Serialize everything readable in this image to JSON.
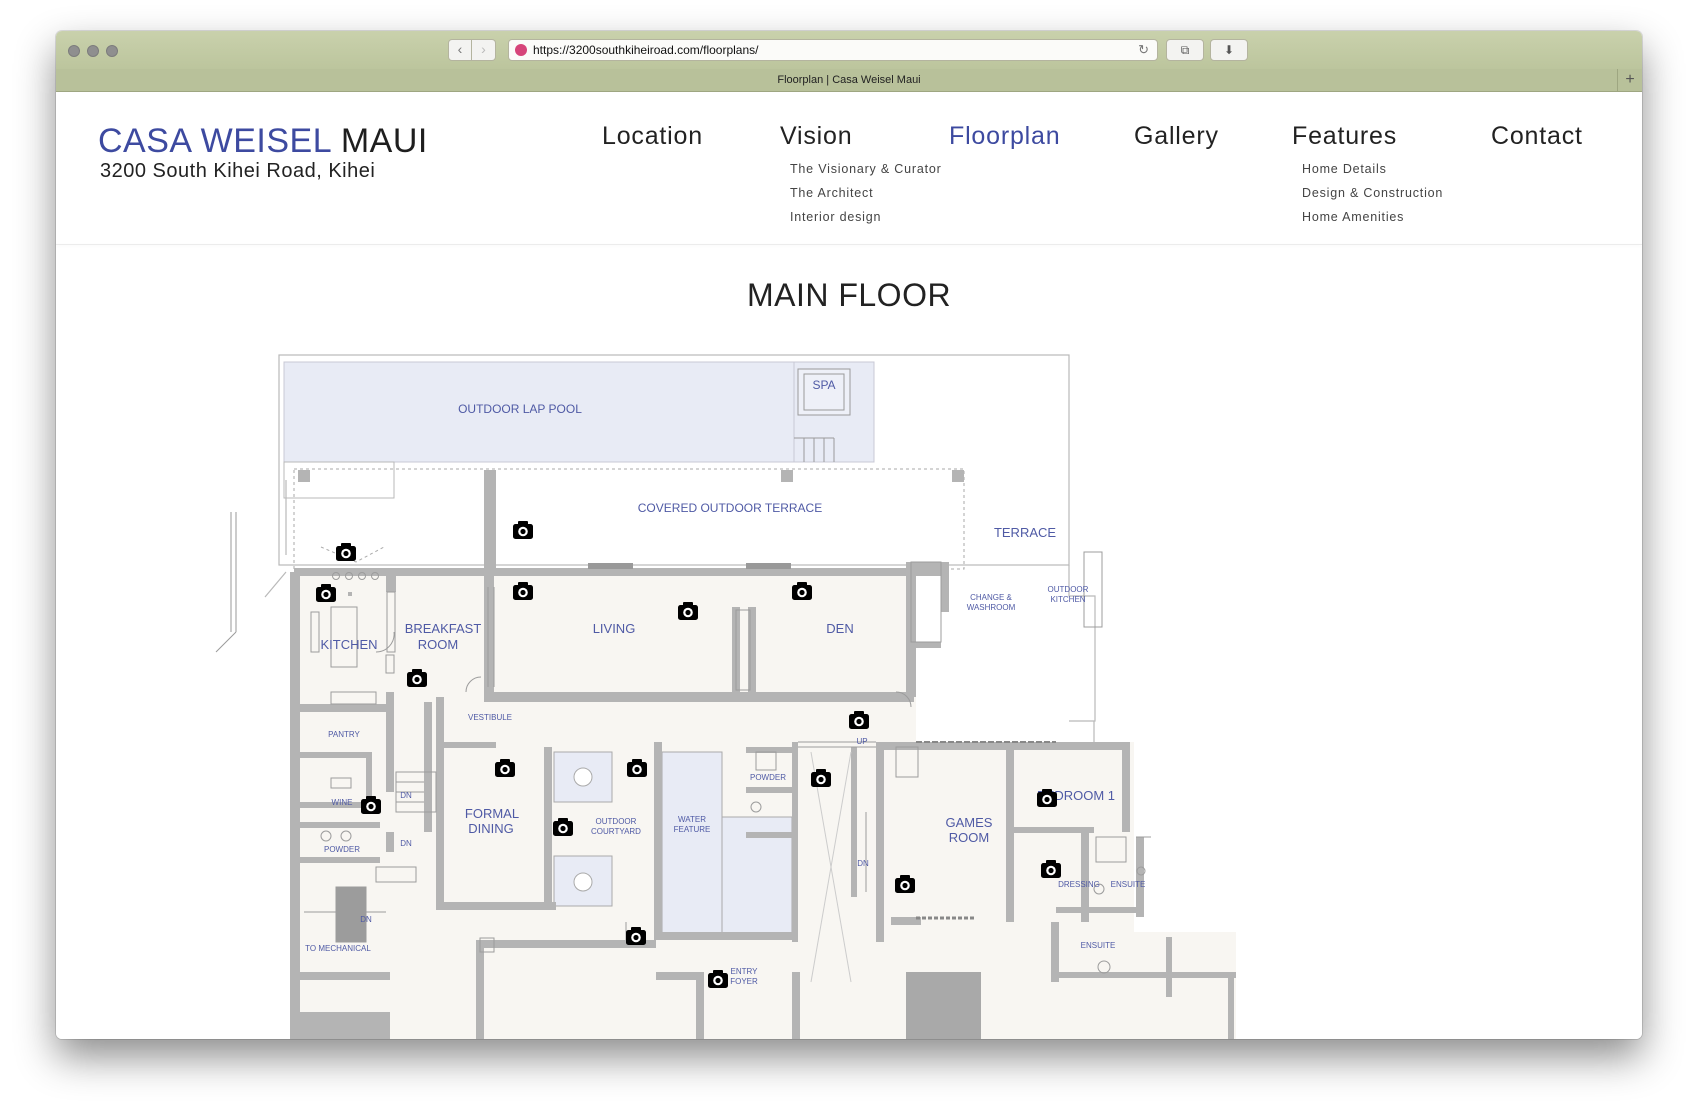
{
  "browser": {
    "url": "https://3200southkiheiroad.com/floorplans/",
    "tab_title": "Floorplan | Casa Weisel Maui",
    "new_tab_symbol": "+"
  },
  "site": {
    "logo_brand": "CASA WEISEL",
    "logo_place": "MAUI",
    "address": "3200 South Kihei Road, Kihei",
    "accent_color": "#3d4aa0"
  },
  "nav": {
    "items": [
      "Location",
      "Vision",
      "Floorplan",
      "Gallery",
      "Features",
      "Contact"
    ],
    "active": "Floorplan",
    "vision_sub": [
      "The Visionary & Curator",
      "The Architect",
      "Interior design"
    ],
    "features_sub": [
      "Home Details",
      "Design & Construction",
      "Home Amenities"
    ]
  },
  "page": {
    "title": "MAIN FLOOR"
  },
  "floorplan": {
    "rooms": {
      "pool": "OUTDOOR LAP POOL",
      "spa": "SPA",
      "covered_terrace": "COVERED OUTDOOR TERRACE",
      "terrace": "TERRACE",
      "kitchen": "KITCHEN",
      "breakfast_1": "BREAKFAST",
      "breakfast_2": "ROOM",
      "living": "LIVING",
      "den": "DEN",
      "change_1": "CHANGE &",
      "change_2": "WASHROOM",
      "outdoor_kitchen_1": "OUTDOOR",
      "outdoor_kitchen_2": "KITCHEN",
      "vestibule": "VESTIBULE",
      "pantry": "PANTRY",
      "wine": "WINE",
      "dn_1": "DN",
      "dn_2": "DN",
      "dn_3": "DN",
      "dn_4": "DN",
      "up": "UP",
      "powder_1": "POWDER",
      "powder_2": "POWDER",
      "formal_dining_1": "FORMAL",
      "formal_dining_2": "DINING",
      "courtyard_1": "OUTDOOR",
      "courtyard_2": "COURTYARD",
      "water_feature_1": "WATER",
      "water_feature_2": "FEATURE",
      "games_room_1": "GAMES",
      "games_room_2": "ROOM",
      "bedroom_1": "BEDROOM 1",
      "dressing": "DRESSING",
      "ensuite_1": "ENSUITE",
      "ensuite_2": "ENSUITE",
      "to_mechanical": "TO MECHANICAL",
      "entry_foyer_1": "ENTRY",
      "entry_foyer_2": "FOYER"
    },
    "camera_icon": "camera-icon",
    "floor_fill": "#f8f6f2",
    "pool_fill": "#e8ebf5",
    "wall_color": "#b4b4b4"
  }
}
